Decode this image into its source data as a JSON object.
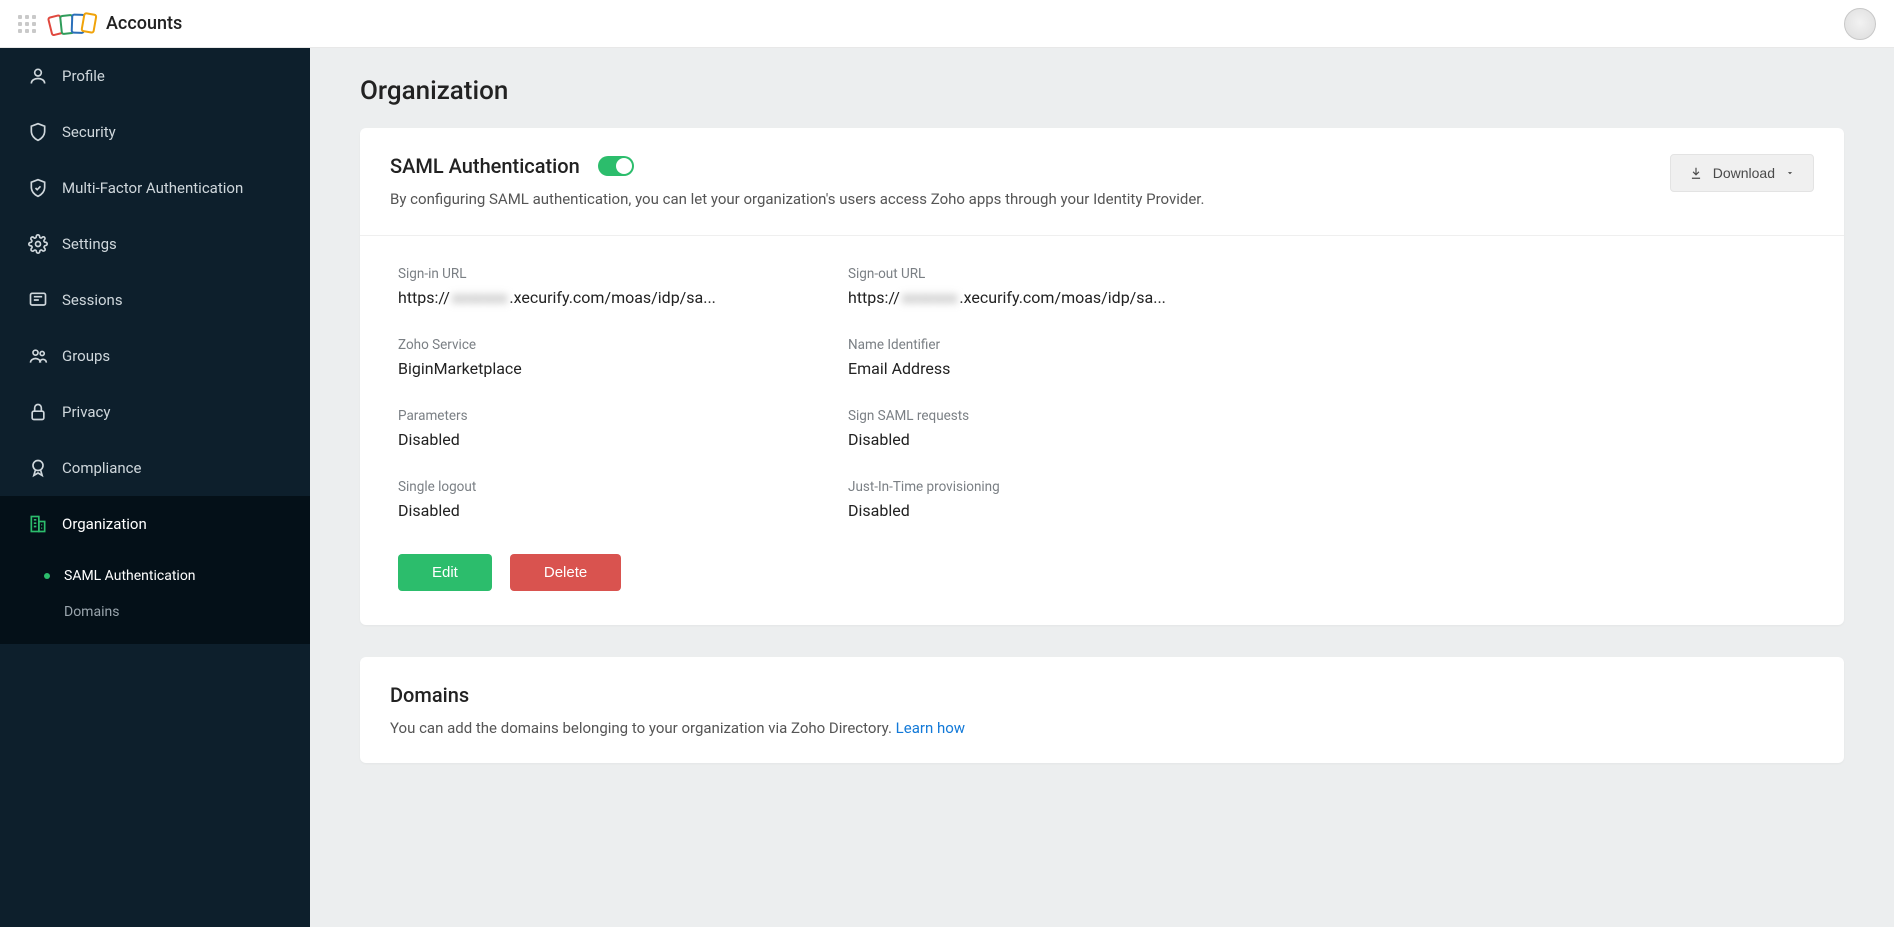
{
  "topbar": {
    "app_name": "Accounts"
  },
  "sidebar": {
    "items": [
      {
        "label": "Profile"
      },
      {
        "label": "Security"
      },
      {
        "label": "Multi-Factor Authentication"
      },
      {
        "label": "Settings"
      },
      {
        "label": "Sessions"
      },
      {
        "label": "Groups"
      },
      {
        "label": "Privacy"
      },
      {
        "label": "Compliance"
      },
      {
        "label": "Organization"
      }
    ],
    "sub_items": [
      {
        "label": "SAML Authentication"
      },
      {
        "label": "Domains"
      }
    ]
  },
  "page": {
    "title": "Organization"
  },
  "saml": {
    "title": "SAML Authentication",
    "description": "By configuring SAML authentication, you can let your organization's users access Zoho apps through your Identity Provider.",
    "download": "Download",
    "fields": {
      "sign_in_url": {
        "label": "Sign-in URL",
        "prefix": "https://",
        "blur": "xxxxxxx",
        "suffix": ".xecurify.com/moas/idp/sa..."
      },
      "sign_out_url": {
        "label": "Sign-out URL",
        "prefix": "https://",
        "blur": "xxxxxxx",
        "suffix": ".xecurify.com/moas/idp/sa..."
      },
      "zoho_service": {
        "label": "Zoho Service",
        "value": "BiginMarketplace"
      },
      "name_identifier": {
        "label": "Name Identifier",
        "value": "Email Address"
      },
      "parameters": {
        "label": "Parameters",
        "value": "Disabled"
      },
      "sign_requests": {
        "label": "Sign SAML requests",
        "value": "Disabled"
      },
      "single_logout": {
        "label": "Single logout",
        "value": "Disabled"
      },
      "jit": {
        "label": "Just-In-Time provisioning",
        "value": "Disabled"
      }
    },
    "buttons": {
      "edit": "Edit",
      "delete": "Delete"
    }
  },
  "domains": {
    "title": "Domains",
    "description": "You can add the domains belonging to your organization via Zoho Directory. ",
    "link": "Learn how"
  }
}
